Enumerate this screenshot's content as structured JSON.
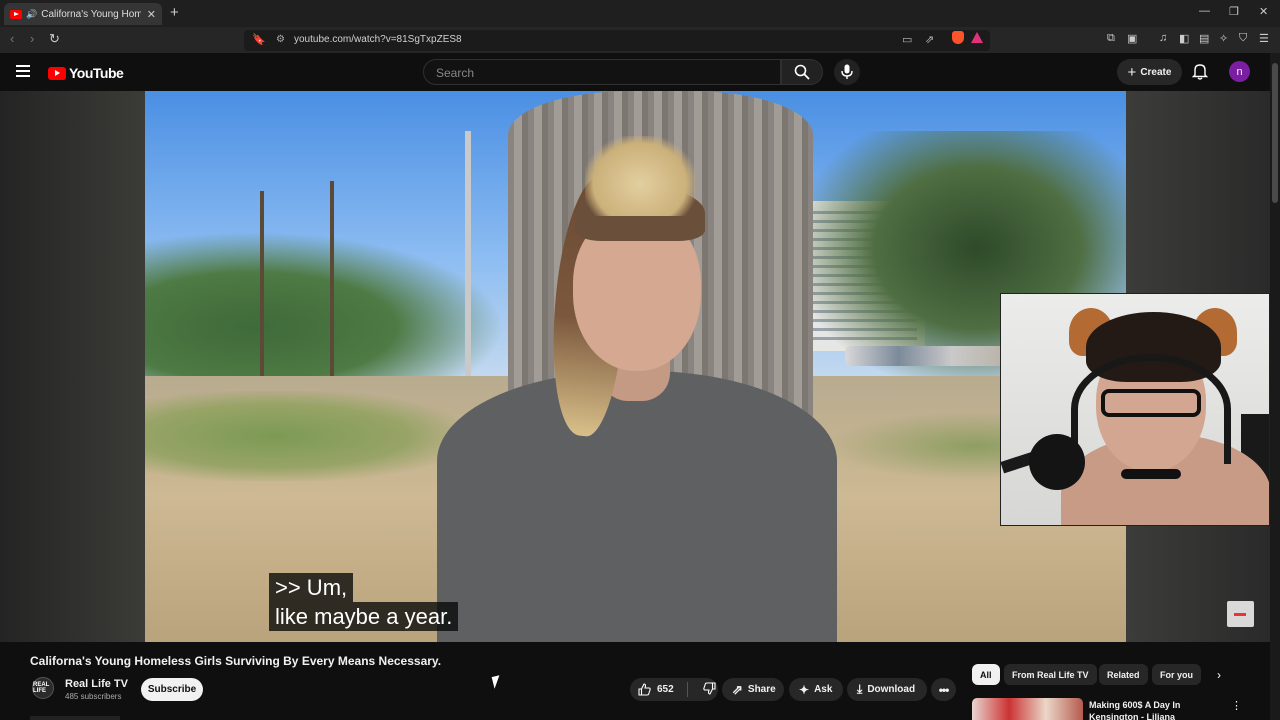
{
  "browser": {
    "tab_title": "Californa's Young Homeless G",
    "url": "youtube.com/watch?v=81SgTxpZES8"
  },
  "masthead": {
    "logo_text": "YouTube",
    "search_placeholder": "Search",
    "create_label": "Create",
    "avatar_letter": "n"
  },
  "player": {
    "caption_lines": [
      ">> Um,",
      "like maybe a year."
    ]
  },
  "video": {
    "title": "Californa's Young Homeless Girls Surviving By Every Means Necessary.",
    "channel_name": "Real Life TV",
    "channel_avatar_text": "REAL LIFE",
    "subscribers": "485 subscribers",
    "subscribe_label": "Subscribe",
    "like_count": "652",
    "share_label": "Share",
    "ask_label": "Ask",
    "download_label": "Download"
  },
  "related": {
    "chips": [
      "All",
      "From Real Life TV",
      "Related",
      "For you"
    ],
    "active_chip": "All",
    "first_item_title": "Making 600$ A Day In Kensington - Liliana"
  },
  "colors": {
    "background": "#0f0f0f",
    "brand_red": "#ff0000",
    "avatar_purple": "#7b1fa2"
  },
  "icons": {
    "tab_audio": "speaker-icon",
    "menu": "hamburger-icon",
    "search": "search-icon",
    "voice": "mic-icon",
    "notifications": "bell-icon",
    "like": "thumbs-up-icon",
    "dislike": "thumbs-down-icon",
    "share": "share-icon",
    "ask": "sparkle-icon",
    "download": "download-icon",
    "more": "more-horizontal-icon"
  }
}
